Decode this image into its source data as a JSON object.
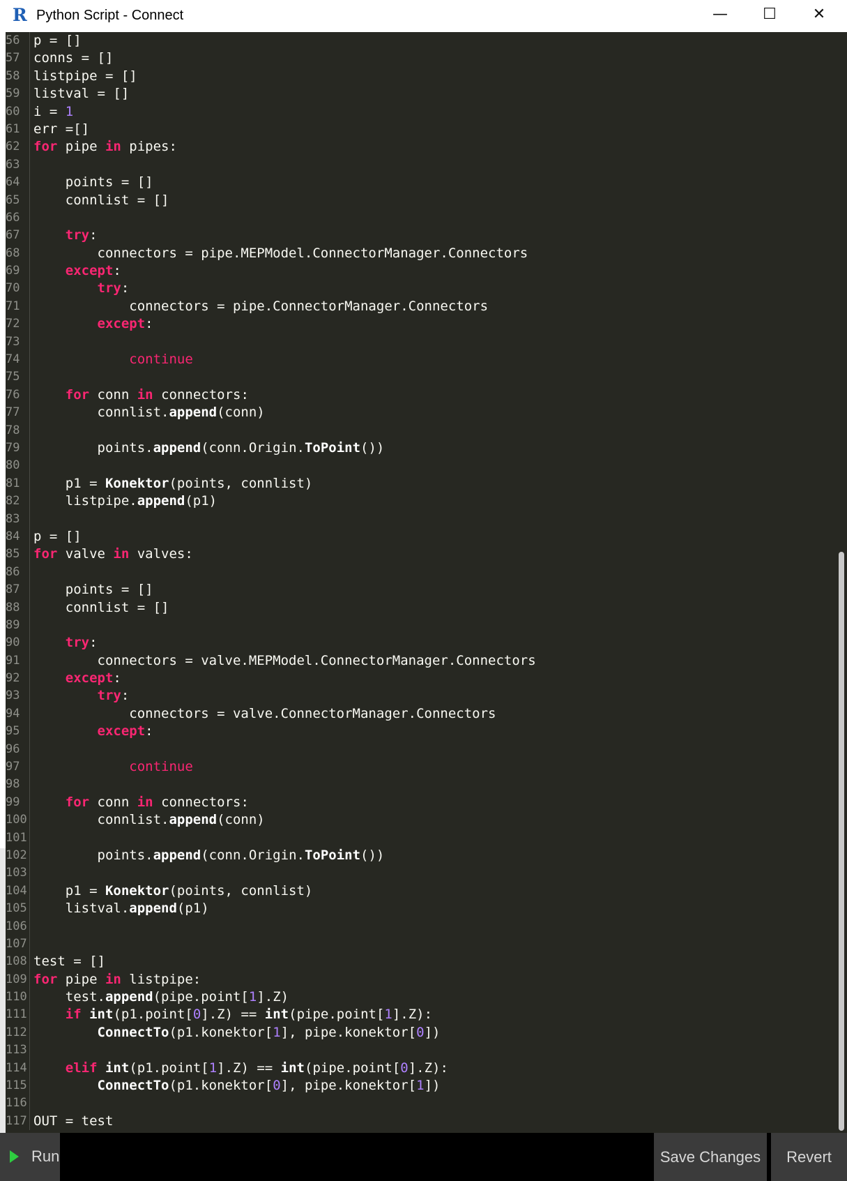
{
  "window": {
    "logo_letter": "R",
    "title": "Python Script - Connect",
    "minimize_glyph": "—",
    "maximize_glyph": "☐",
    "close_glyph": "✕"
  },
  "editor": {
    "theme": {
      "background": "#272822",
      "keyword": "#f92672",
      "number": "#ae81ff",
      "text": "#f8f8f2",
      "line_number": "#8f908a"
    },
    "lines": [
      {
        "n": "56",
        "t": [
          [
            "p = []",
            "pl"
          ]
        ]
      },
      {
        "n": "57",
        "t": [
          [
            "conns = []",
            "pl"
          ]
        ]
      },
      {
        "n": "58",
        "t": [
          [
            "listpipe = []",
            "pl"
          ]
        ]
      },
      {
        "n": "59",
        "t": [
          [
            "listval = []",
            "pl"
          ]
        ]
      },
      {
        "n": "60",
        "t": [
          [
            "i = ",
            "pl"
          ],
          [
            "1",
            "num"
          ]
        ]
      },
      {
        "n": "61",
        "t": [
          [
            "err =[]",
            "pl"
          ]
        ]
      },
      {
        "n": "62",
        "t": [
          [
            "for",
            "kw"
          ],
          [
            " pipe ",
            "pl"
          ],
          [
            "in",
            "kw"
          ],
          [
            " pipes:",
            "pl"
          ]
        ]
      },
      {
        "n": "63",
        "t": []
      },
      {
        "n": "64",
        "t": [
          [
            "    points = []",
            "pl"
          ]
        ]
      },
      {
        "n": "65",
        "t": [
          [
            "    connlist = []",
            "pl"
          ]
        ]
      },
      {
        "n": "66",
        "t": []
      },
      {
        "n": "67",
        "t": [
          [
            "    ",
            "pl"
          ],
          [
            "try",
            "kw"
          ],
          [
            ":",
            "pl"
          ]
        ]
      },
      {
        "n": "68",
        "t": [
          [
            "        connectors = pipe.MEPModel.ConnectorManager.Connectors",
            "pl"
          ]
        ]
      },
      {
        "n": "69",
        "t": [
          [
            "    ",
            "pl"
          ],
          [
            "except",
            "kw"
          ],
          [
            ":",
            "pl"
          ]
        ]
      },
      {
        "n": "70",
        "t": [
          [
            "        ",
            "pl"
          ],
          [
            "try",
            "kw"
          ],
          [
            ":",
            "pl"
          ]
        ]
      },
      {
        "n": "71",
        "t": [
          [
            "            connectors = pipe.ConnectorManager.Connectors",
            "pl"
          ]
        ]
      },
      {
        "n": "72",
        "t": [
          [
            "        ",
            "pl"
          ],
          [
            "except",
            "kw"
          ],
          [
            ":",
            "pl"
          ]
        ]
      },
      {
        "n": "73",
        "t": []
      },
      {
        "n": "74",
        "t": [
          [
            "            ",
            "pl"
          ],
          [
            "continue",
            "ctl"
          ]
        ]
      },
      {
        "n": "75",
        "t": []
      },
      {
        "n": "76",
        "t": [
          [
            "    ",
            "pl"
          ],
          [
            "for",
            "kw"
          ],
          [
            " conn ",
            "pl"
          ],
          [
            "in",
            "kw"
          ],
          [
            " connectors:",
            "pl"
          ]
        ]
      },
      {
        "n": "77",
        "t": [
          [
            "        connlist.",
            "pl"
          ],
          [
            "append",
            "fn"
          ],
          [
            "(conn)",
            "pl"
          ]
        ]
      },
      {
        "n": "78",
        "t": []
      },
      {
        "n": "79",
        "t": [
          [
            "        points.",
            "pl"
          ],
          [
            "append",
            "fn"
          ],
          [
            "(conn.Origin.",
            "pl"
          ],
          [
            "ToPoint",
            "fn"
          ],
          [
            "())",
            "pl"
          ]
        ]
      },
      {
        "n": "80",
        "t": []
      },
      {
        "n": "81",
        "t": [
          [
            "    p1 = ",
            "pl"
          ],
          [
            "Konektor",
            "fn"
          ],
          [
            "(points, connlist)",
            "pl"
          ]
        ]
      },
      {
        "n": "82",
        "t": [
          [
            "    listpipe.",
            "pl"
          ],
          [
            "append",
            "fn"
          ],
          [
            "(p1)",
            "pl"
          ]
        ]
      },
      {
        "n": "83",
        "t": []
      },
      {
        "n": "84",
        "t": [
          [
            "p = []",
            "pl"
          ]
        ]
      },
      {
        "n": "85",
        "t": [
          [
            "for",
            "kw"
          ],
          [
            " valve ",
            "pl"
          ],
          [
            "in",
            "kw"
          ],
          [
            " valves:",
            "pl"
          ]
        ]
      },
      {
        "n": "86",
        "t": []
      },
      {
        "n": "87",
        "t": [
          [
            "    points = []",
            "pl"
          ]
        ]
      },
      {
        "n": "88",
        "t": [
          [
            "    connlist = []",
            "pl"
          ]
        ]
      },
      {
        "n": "89",
        "t": []
      },
      {
        "n": "90",
        "t": [
          [
            "    ",
            "pl"
          ],
          [
            "try",
            "kw"
          ],
          [
            ":",
            "pl"
          ]
        ]
      },
      {
        "n": "91",
        "t": [
          [
            "        connectors = valve.MEPModel.ConnectorManager.Connectors",
            "pl"
          ]
        ]
      },
      {
        "n": "92",
        "t": [
          [
            "    ",
            "pl"
          ],
          [
            "except",
            "kw"
          ],
          [
            ":",
            "pl"
          ]
        ]
      },
      {
        "n": "93",
        "t": [
          [
            "        ",
            "pl"
          ],
          [
            "try",
            "kw"
          ],
          [
            ":",
            "pl"
          ]
        ]
      },
      {
        "n": "94",
        "t": [
          [
            "            connectors = valve.ConnectorManager.Connectors",
            "pl"
          ]
        ]
      },
      {
        "n": "95",
        "t": [
          [
            "        ",
            "pl"
          ],
          [
            "except",
            "kw"
          ],
          [
            ":",
            "pl"
          ]
        ]
      },
      {
        "n": "96",
        "t": []
      },
      {
        "n": "97",
        "t": [
          [
            "            ",
            "pl"
          ],
          [
            "continue",
            "ctl"
          ]
        ]
      },
      {
        "n": "98",
        "t": []
      },
      {
        "n": "99",
        "t": [
          [
            "    ",
            "pl"
          ],
          [
            "for",
            "kw"
          ],
          [
            " conn ",
            "pl"
          ],
          [
            "in",
            "kw"
          ],
          [
            " connectors:",
            "pl"
          ]
        ]
      },
      {
        "n": "100",
        "t": [
          [
            "        connlist.",
            "pl"
          ],
          [
            "append",
            "fn"
          ],
          [
            "(conn)",
            "pl"
          ]
        ]
      },
      {
        "n": "101",
        "t": []
      },
      {
        "n": "102",
        "t": [
          [
            "        points.",
            "pl"
          ],
          [
            "append",
            "fn"
          ],
          [
            "(conn.Origin.",
            "pl"
          ],
          [
            "ToPoint",
            "fn"
          ],
          [
            "())",
            "pl"
          ]
        ]
      },
      {
        "n": "103",
        "t": []
      },
      {
        "n": "104",
        "t": [
          [
            "    p1 = ",
            "pl"
          ],
          [
            "Konektor",
            "fn"
          ],
          [
            "(points, connlist)",
            "pl"
          ]
        ]
      },
      {
        "n": "105",
        "t": [
          [
            "    listval.",
            "pl"
          ],
          [
            "append",
            "fn"
          ],
          [
            "(p1)",
            "pl"
          ]
        ]
      },
      {
        "n": "106",
        "t": []
      },
      {
        "n": "107",
        "t": []
      },
      {
        "n": "108",
        "t": [
          [
            "test = []",
            "pl"
          ]
        ]
      },
      {
        "n": "109",
        "t": [
          [
            "for",
            "kw"
          ],
          [
            " pipe ",
            "pl"
          ],
          [
            "in",
            "kw"
          ],
          [
            " listpipe:",
            "pl"
          ]
        ]
      },
      {
        "n": "110",
        "t": [
          [
            "    test.",
            "pl"
          ],
          [
            "append",
            "fn"
          ],
          [
            "(pipe.point[",
            "pl"
          ],
          [
            "1",
            "num"
          ],
          [
            "].Z)",
            "pl"
          ]
        ]
      },
      {
        "n": "111",
        "t": [
          [
            "    ",
            "pl"
          ],
          [
            "if",
            "kw"
          ],
          [
            " ",
            "pl"
          ],
          [
            "int",
            "fn"
          ],
          [
            "(p1.point[",
            "pl"
          ],
          [
            "0",
            "num"
          ],
          [
            "].Z) == ",
            "pl"
          ],
          [
            "int",
            "fn"
          ],
          [
            "(pipe.point[",
            "pl"
          ],
          [
            "1",
            "num"
          ],
          [
            "].Z):",
            "pl"
          ]
        ]
      },
      {
        "n": "112",
        "t": [
          [
            "        ",
            "pl"
          ],
          [
            "ConnectTo",
            "fn"
          ],
          [
            "(p1.konektor[",
            "pl"
          ],
          [
            "1",
            "num"
          ],
          [
            "], pipe.konektor[",
            "pl"
          ],
          [
            "0",
            "num"
          ],
          [
            "])",
            "pl"
          ]
        ]
      },
      {
        "n": "113",
        "t": []
      },
      {
        "n": "114",
        "t": [
          [
            "    ",
            "pl"
          ],
          [
            "elif",
            "kw"
          ],
          [
            " ",
            "pl"
          ],
          [
            "int",
            "fn"
          ],
          [
            "(p1.point[",
            "pl"
          ],
          [
            "1",
            "num"
          ],
          [
            "].Z) == ",
            "pl"
          ],
          [
            "int",
            "fn"
          ],
          [
            "(pipe.point[",
            "pl"
          ],
          [
            "0",
            "num"
          ],
          [
            "].Z):",
            "pl"
          ]
        ]
      },
      {
        "n": "115",
        "t": [
          [
            "        ",
            "pl"
          ],
          [
            "ConnectTo",
            "fn"
          ],
          [
            "(p1.konektor[",
            "pl"
          ],
          [
            "0",
            "num"
          ],
          [
            "], pipe.konektor[",
            "pl"
          ],
          [
            "1",
            "num"
          ],
          [
            "])",
            "pl"
          ]
        ]
      },
      {
        "n": "116",
        "t": []
      },
      {
        "n": "117",
        "t": [
          [
            "OUT = test",
            "pl"
          ]
        ]
      }
    ]
  },
  "footer": {
    "run_label": "Run",
    "save_label": "Save Changes",
    "revert_label": "Revert"
  }
}
